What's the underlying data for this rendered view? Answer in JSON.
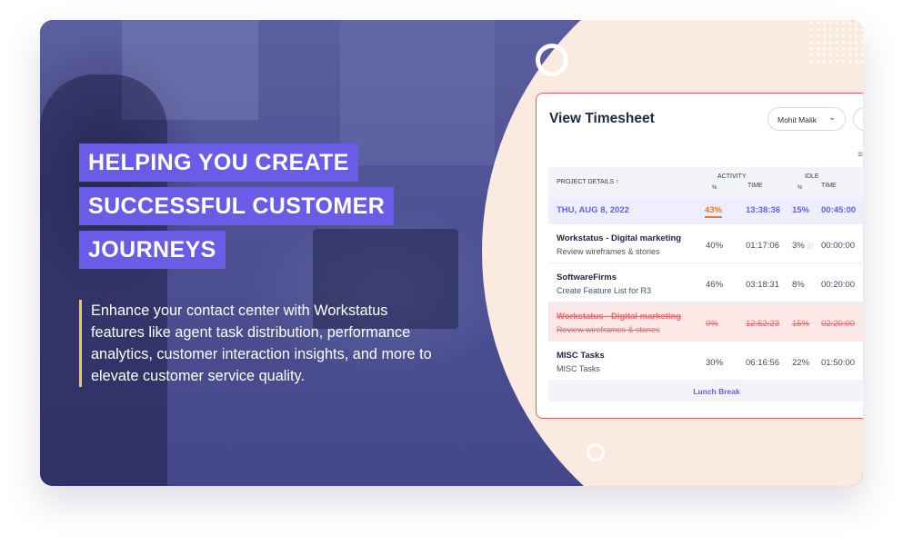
{
  "hero": {
    "heading_lines": [
      "HELPING YOU CREATE",
      "SUCCESSFUL CUSTOMER",
      "JOURNEYS"
    ],
    "description": "Enhance your contact center with Workstatus features like agent task distribution, performance analytics, customer interaction insights, and more to  elevate customer service quality."
  },
  "timesheet": {
    "title": "View Timesheet",
    "user_select": "Mohit Malik",
    "columns": {
      "project": "PROJECT DETAILS ↑",
      "activity": "ACTIVITY",
      "activity_pct": "%",
      "activity_time": "TIME",
      "idle": "IDLE",
      "idle_pct": "%",
      "idle_time": "TIME"
    },
    "date_row": {
      "date": "THU, AUG 8, 2022",
      "activity_pct": "43%",
      "activity_time": "13:38:36",
      "idle_pct": "15%",
      "idle_time": "00:45:00"
    },
    "rows": [
      {
        "project": "Workstatus - Digital marketing",
        "task": "Review wireframes & stories",
        "activity_pct": "40%",
        "activity_time": "01:17:06",
        "idle_pct": "3%",
        "idle_time": "00:00:00"
      },
      {
        "project": "SoftwareFirms",
        "task": "Create Feature List for R3",
        "activity_pct": "46%",
        "activity_time": "03:18:31",
        "idle_pct": "8%",
        "idle_time": "00:20:00"
      },
      {
        "project": "Workstatus - Digital marketing",
        "task": "Review wireframes & stories",
        "activity_pct": "0%",
        "activity_time": "12:52:23",
        "idle_pct": "15%",
        "idle_time": "02:20:00"
      },
      {
        "project": "MISC Tasks",
        "task": "MISC Tasks",
        "activity_pct": "30%",
        "activity_time": "06:16:56",
        "idle_pct": "22%",
        "idle_time": "01:50:00"
      }
    ],
    "lunch_break": "Lunch Break"
  },
  "colors": {
    "accent": "#6a5ce6",
    "highlight": "#f2c94c",
    "warning": "#e27c2a",
    "strike": "#e26b6b"
  }
}
